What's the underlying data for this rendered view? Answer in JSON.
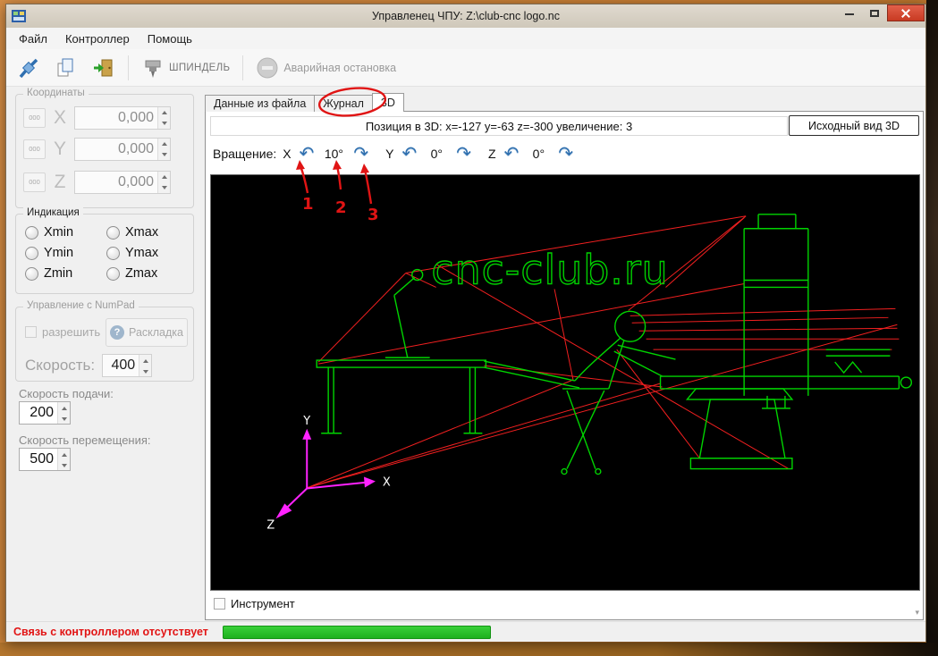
{
  "window": {
    "title": "Управленец ЧПУ: Z:\\club-cnc logo.nc"
  },
  "menu": {
    "items": [
      {
        "label": "Файл"
      },
      {
        "label": "Контроллер"
      },
      {
        "label": "Помощь"
      }
    ]
  },
  "toolbar": {
    "spindle_label": "ШПИНДЕЛЬ",
    "estop_label": "Аварийная остановка"
  },
  "coordinates": {
    "group_label": "Координаты",
    "axes": [
      {
        "zero": "000",
        "axis": "X",
        "value": "0,000"
      },
      {
        "zero": "000",
        "axis": "Y",
        "value": "0,000"
      },
      {
        "zero": "000",
        "axis": "Z",
        "value": "0,000"
      }
    ]
  },
  "indication": {
    "group_label": "Индикация",
    "options": [
      "Xmin",
      "Xmax",
      "Ymin",
      "Ymax",
      "Zmin",
      "Zmax"
    ]
  },
  "numpad": {
    "group_label": "Управление с NumPad",
    "enable_label": "разрешить",
    "layout_icon": "?",
    "layout_label": "Раскладка",
    "speed_label": "Скорость:",
    "speed_value": "400"
  },
  "feeds": {
    "feed_label": "Скорость подачи:",
    "feed_value": "200",
    "move_label": "Скорость перемещения:",
    "move_value": "500"
  },
  "tabs": [
    {
      "label": "Данные из файла"
    },
    {
      "label": "Журнал"
    },
    {
      "label": "3D"
    }
  ],
  "viewer": {
    "position_text": "Позиция в 3D: x=-127 y=-63 z=-300 увеличение: 3",
    "reset_button": "Исходный вид 3D",
    "rotation_label": "Вращение:",
    "x_label": "X",
    "x_value": "10°",
    "y_label": "Y",
    "y_value": "0°",
    "z_label": "Z",
    "z_value": "0°",
    "rotate_ccw_icon": "↶",
    "rotate_cw_icon": "↷",
    "logo_text": "cnc-club.ru",
    "axis_x": "X",
    "axis_y": "Y",
    "axis_z": "Z",
    "tool_checkbox": "Инструмент"
  },
  "annotations": {
    "numbers": [
      "1",
      "2",
      "3"
    ]
  },
  "statusbar": {
    "text": "Связь с контроллером отсутствует"
  },
  "colors": {
    "wireframe": "#00d400",
    "rapid": "#ff2222",
    "axes_magenta": "#ff22ff",
    "annotation_red": "#e01414",
    "progress_green": "#28c428"
  }
}
